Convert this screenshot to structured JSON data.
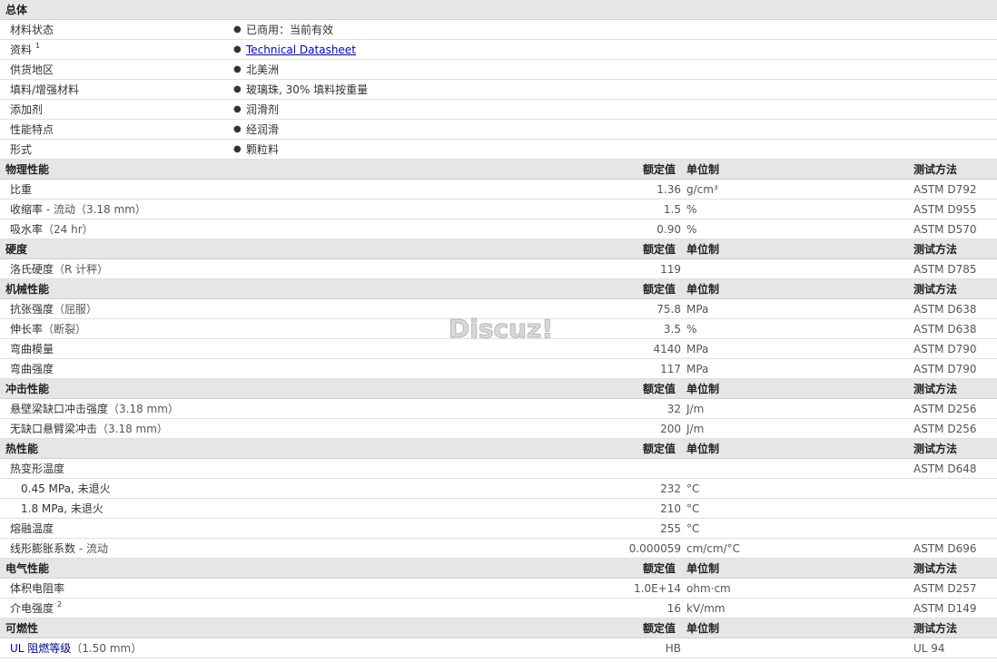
{
  "watermark": "Discuz!",
  "headers": {
    "nominal": "额定值",
    "unit": "单位制",
    "test": "测试方法"
  },
  "general": {
    "title": "总体",
    "items": [
      {
        "label": "材料状态",
        "value": "已商用：当前有效"
      },
      {
        "label": "资料",
        "sup": "1",
        "value": "Technical Datasheet",
        "link": true
      },
      {
        "label": "供货地区",
        "value": "北美洲"
      },
      {
        "label": "填料/增强材料",
        "value": "玻璃珠, 30% 填料按重量"
      },
      {
        "label": "添加剂",
        "value": "润滑剂"
      },
      {
        "label": "性能特点",
        "value": "经润滑"
      },
      {
        "label": "形式",
        "value": "颗粒料"
      }
    ]
  },
  "sections": [
    {
      "title": "物理性能",
      "rows": [
        {
          "label": "比重",
          "cond": "",
          "value": "1.36",
          "unit": "g/cm³",
          "test": "ASTM D792"
        },
        {
          "label": "收缩率",
          "cond": " - 流动（3.18 mm）",
          "value": "1.5",
          "unit": "%",
          "test": "ASTM D955"
        },
        {
          "label": "吸水率",
          "cond": "（24 hr）",
          "value": "0.90",
          "unit": "%",
          "test": "ASTM D570"
        }
      ]
    },
    {
      "title": "硬度",
      "rows": [
        {
          "label": "洛氏硬度",
          "cond": "（R 计秤）",
          "value": "119",
          "unit": "",
          "test": "ASTM D785"
        }
      ]
    },
    {
      "title": "机械性能",
      "rows": [
        {
          "label": "抗张强度",
          "cond": "（屈服）",
          "value": "75.8",
          "unit": "MPa",
          "test": "ASTM D638"
        },
        {
          "label": "伸长率",
          "cond": "（断裂）",
          "value": "3.5",
          "unit": "%",
          "test": "ASTM D638"
        },
        {
          "label": "弯曲模量",
          "cond": "",
          "value": "4140",
          "unit": "MPa",
          "test": "ASTM D790"
        },
        {
          "label": "弯曲强度",
          "cond": "",
          "value": "117",
          "unit": "MPa",
          "test": "ASTM D790"
        }
      ]
    },
    {
      "title": "冲击性能",
      "rows": [
        {
          "label": "悬壁梁缺口冲击强度",
          "cond": "（3.18 mm）",
          "value": "32",
          "unit": "J/m",
          "test": "ASTM D256"
        },
        {
          "label": "无缺口悬臂梁冲击",
          "cond": "（3.18 mm）",
          "value": "200",
          "unit": "J/m",
          "test": "ASTM D256"
        }
      ]
    },
    {
      "title": "热性能",
      "rows": [
        {
          "label": "热变形温度",
          "cond": "",
          "value": "",
          "unit": "",
          "test": "ASTM D648"
        },
        {
          "label": "0.45 MPa, 未退火",
          "cond": "",
          "value": "232",
          "unit": "°C",
          "test": "",
          "sub": true
        },
        {
          "label": "1.8 MPa, 未退火",
          "cond": "",
          "value": "210",
          "unit": "°C",
          "test": "",
          "sub": true
        },
        {
          "label": "熔融温度",
          "cond": "",
          "value": "255",
          "unit": "°C",
          "test": ""
        },
        {
          "label": "线形膨胀系数",
          "cond": " - 流动",
          "value": "0.000059",
          "unit": "cm/cm/°C",
          "test": "ASTM D696"
        }
      ]
    },
    {
      "title": "电气性能",
      "rows": [
        {
          "label": "体积电阻率",
          "cond": "",
          "value": "1.0E+14",
          "unit": "ohm·cm",
          "test": "ASTM D257"
        },
        {
          "label": "介电强度",
          "sup": "2",
          "cond": "",
          "value": "16",
          "unit": "kV/mm",
          "test": "ASTM D149"
        }
      ]
    },
    {
      "title": "可燃性",
      "rows": [
        {
          "label": "UL 阻燃等级",
          "cond": "（1.50 mm）",
          "value": "HB",
          "unit": "",
          "test": "UL 94",
          "labelLink": true
        }
      ]
    }
  ]
}
